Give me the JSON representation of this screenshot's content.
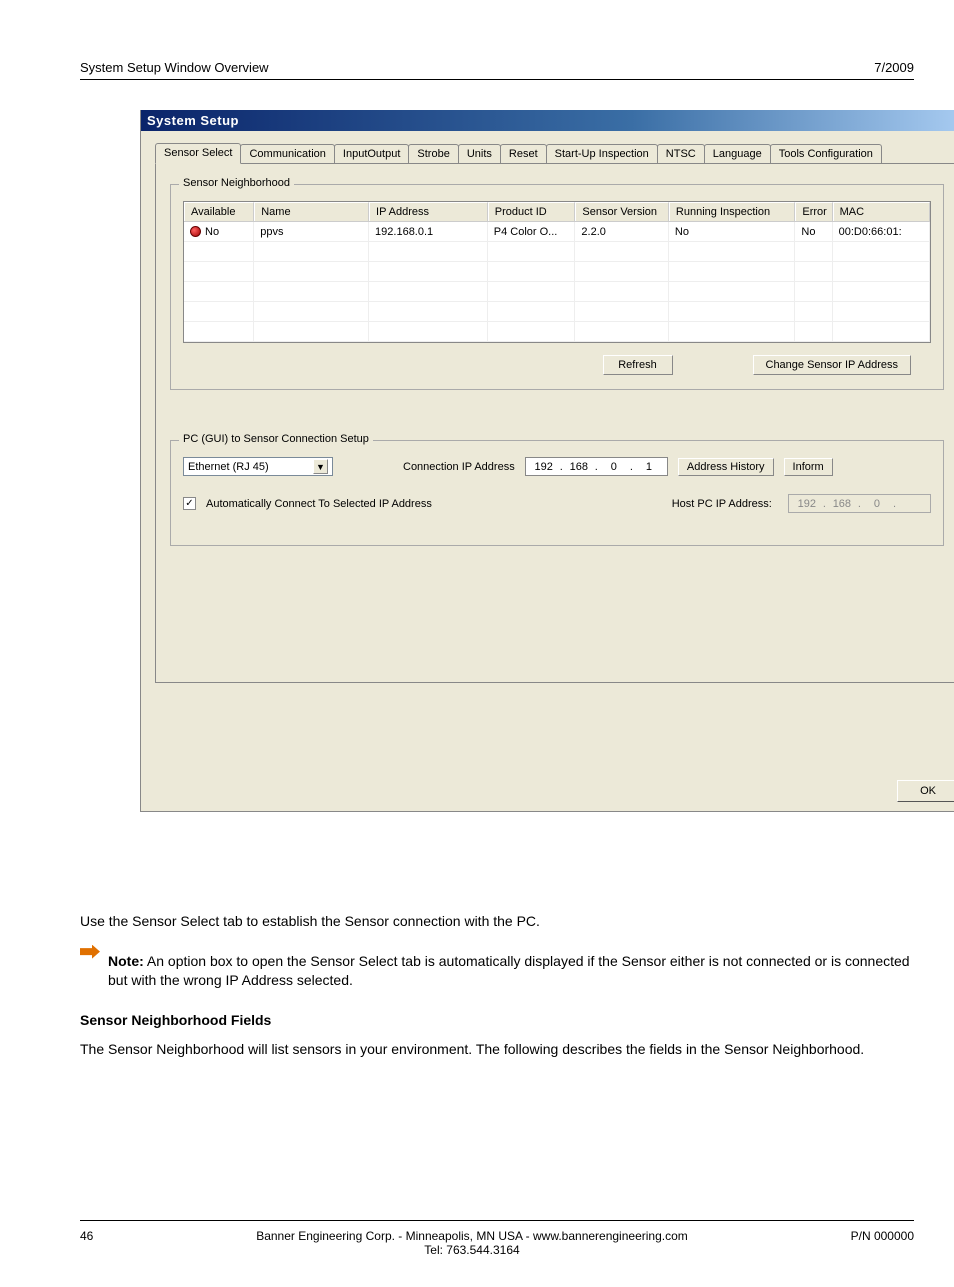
{
  "page_header": {
    "left": "System Setup Window Overview",
    "right": "7/2009"
  },
  "window": {
    "title": "System  Setup",
    "tabs": [
      "Sensor Select",
      "Communication",
      "InputOutput",
      "Strobe",
      "Units",
      "Reset",
      "Start-Up Inspection",
      "NTSC",
      "Language",
      "Tools Configuration"
    ],
    "neighborhood": {
      "legend": "Sensor Neighborhood",
      "columns": [
        "Available",
        "Name",
        "IP Address",
        "Product ID",
        "Sensor Version",
        "Running Inspection",
        "Error",
        "MAC"
      ],
      "row": {
        "available": "No",
        "name": "ppvs",
        "ip": "192.168.0.1",
        "product": "P4 Color O...",
        "version": "2.2.0",
        "running": "No",
        "error": "No",
        "mac": "00:D0:66:01:"
      },
      "btn_refresh": "Refresh",
      "btn_change": "Change Sensor IP Address"
    },
    "conn": {
      "legend": "PC (GUI) to Sensor Connection Setup",
      "select_value": "Ethernet (RJ 45)",
      "ip_label": "Connection IP Address",
      "ip": [
        "192",
        "168",
        "0",
        "1"
      ],
      "history_btn": "Address History",
      "inform_btn": "Inform",
      "auto_label": "Automatically Connect To Selected IP Address",
      "host_label": "Host PC IP Address:",
      "host_ip": [
        "192",
        "168",
        "0",
        ""
      ]
    },
    "ok": "OK"
  },
  "body": {
    "p1": "Use the Sensor Select tab  to establish the Sensor connection with the PC.",
    "note_label": "Note:",
    "note_text": "An option box to open the Sensor Select tab is automatically displayed if the Sensor either is not connected or is connected but with the wrong IP Address selected.",
    "h2": "Sensor Neighborhood Fields",
    "p2": "The Sensor Neighborhood will list sensors in your environment. The following describes the fields in the Sensor Neighborhood."
  },
  "footer": {
    "page": "46",
    "center1": "Banner Engineering Corp. - Minneapolis, MN USA - www.bannerengineering.com",
    "center2": "Tel: 763.544.3164",
    "right": "P/N 000000"
  }
}
